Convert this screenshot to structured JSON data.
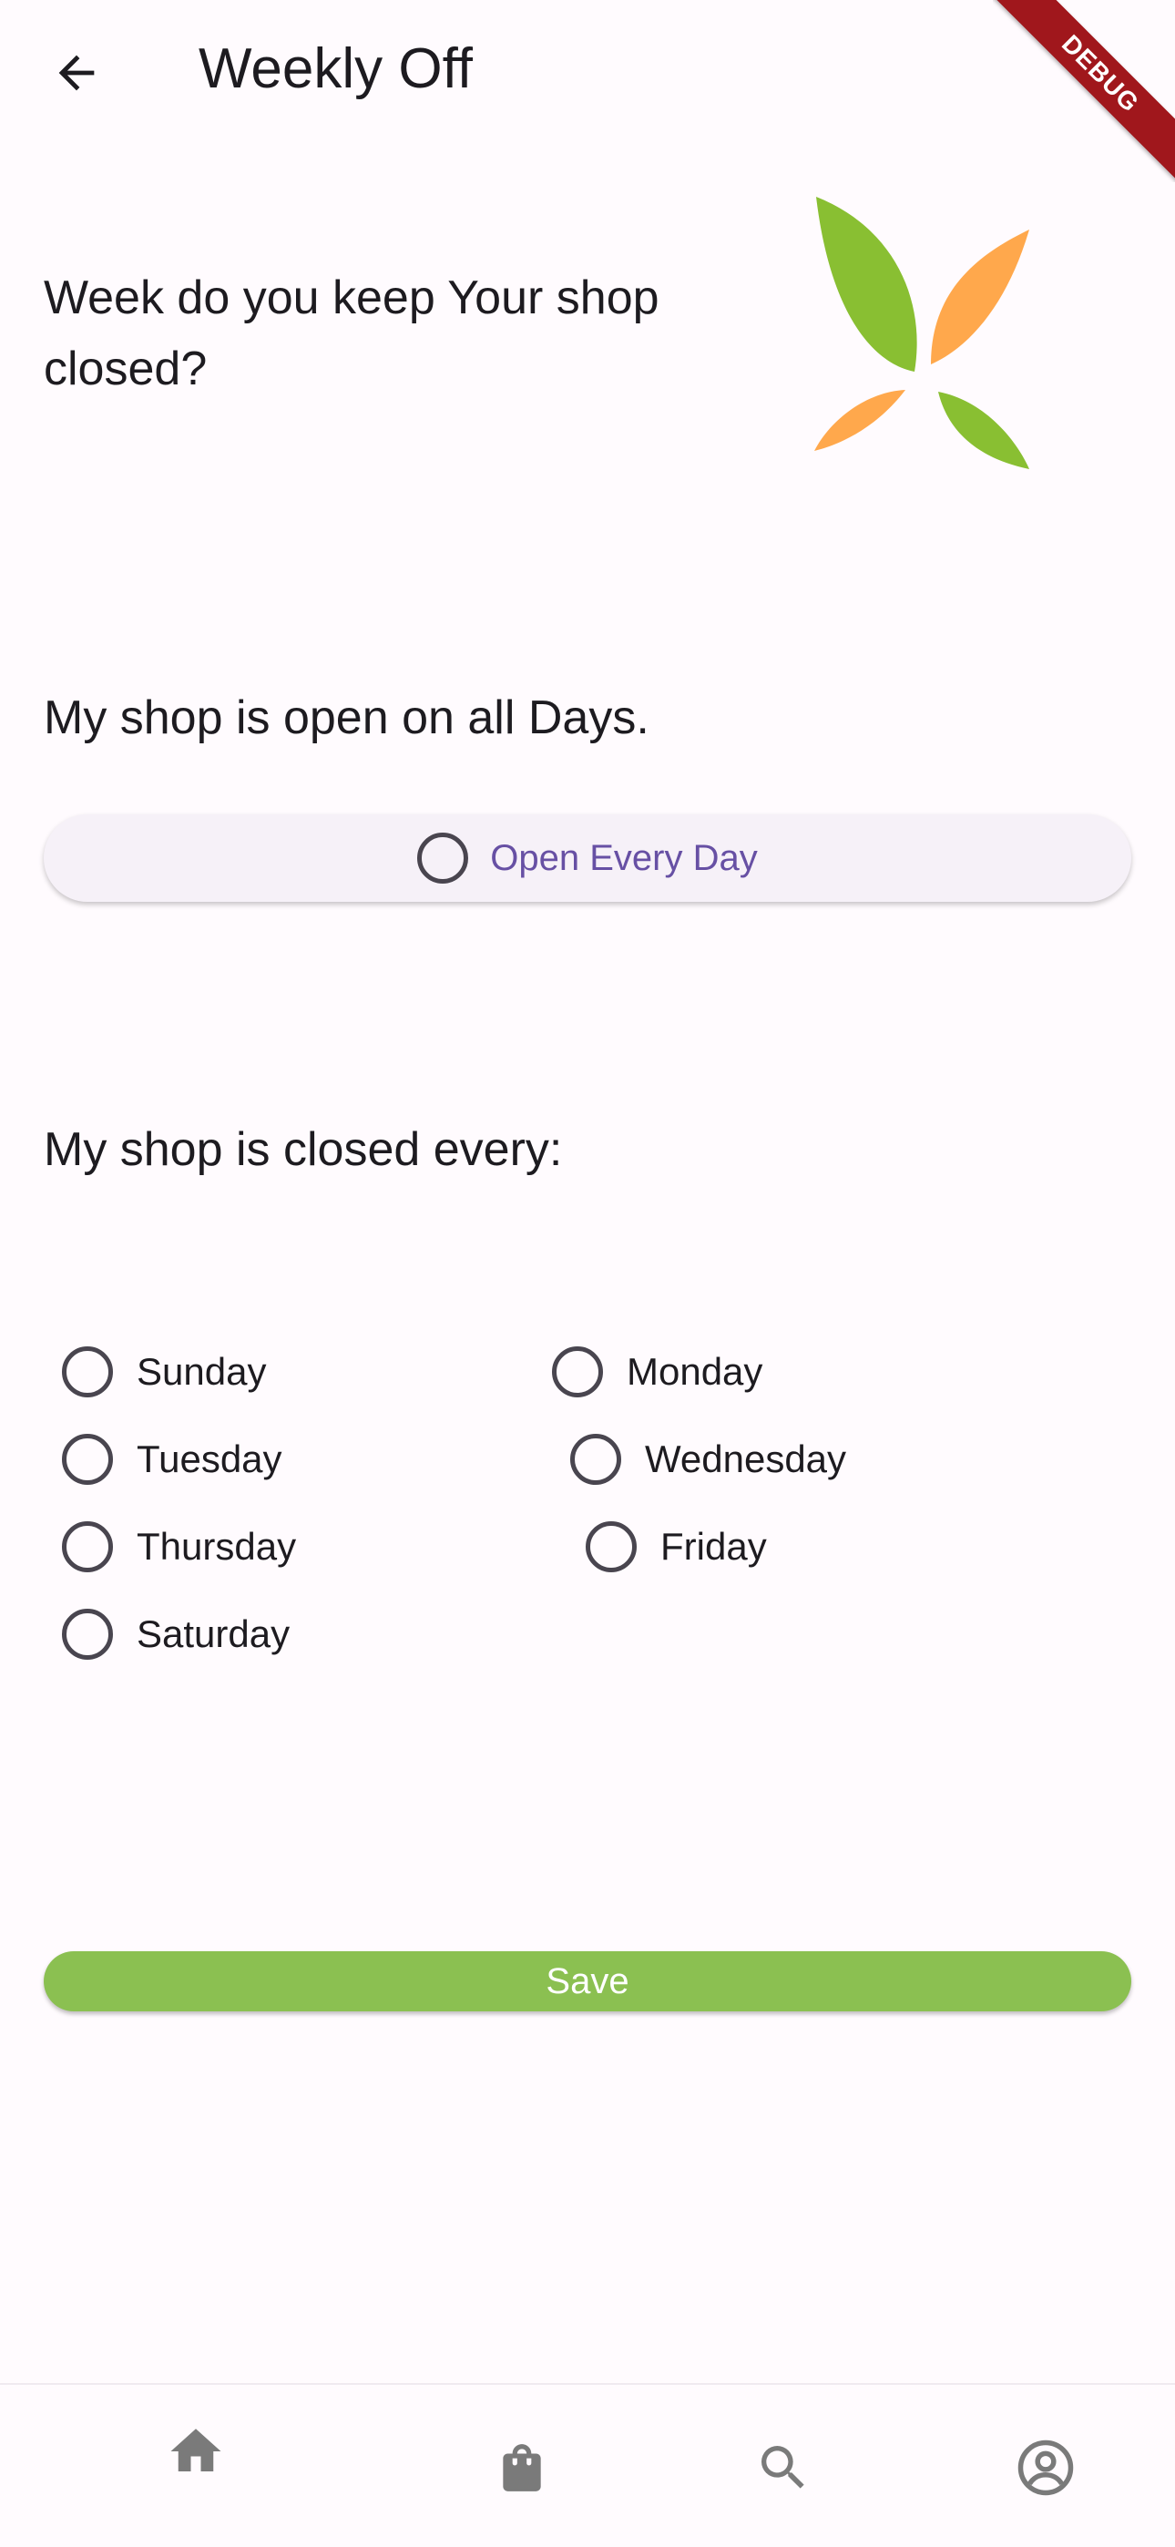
{
  "appbar": {
    "title": "Weekly Off",
    "back_icon": "arrow-back-icon"
  },
  "debug_banner": {
    "text": "DEBUG"
  },
  "question": "Week do you keep Your shop closed?",
  "open_section": {
    "label": "My shop is open on all Days.",
    "button_label": "Open Every Day"
  },
  "closed_section": {
    "label": "My shop is closed every:"
  },
  "days": {
    "sunday": "Sunday",
    "monday": "Monday",
    "tuesday": "Tuesday",
    "wednesday": "Wednesday",
    "thursday": "Thursday",
    "friday": "Friday",
    "saturday": "Saturday"
  },
  "save_label": "Save",
  "bottom_nav": {
    "items": [
      "home-icon",
      "shopping-bag-icon",
      "search-icon",
      "account-circle-icon"
    ]
  },
  "colors": {
    "accent_green": "#8bc051",
    "logo_orange": "#ffa84c",
    "logo_green": "#89bf32",
    "primary_purple": "#6750a4",
    "debug_red": "#a0171c"
  }
}
